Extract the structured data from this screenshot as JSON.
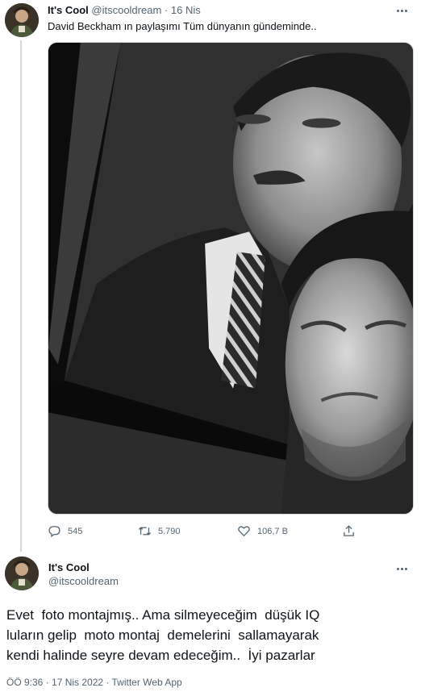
{
  "tweet": {
    "author_name": "It's Cool",
    "author_handle": "@itscooldream",
    "separator": "·",
    "date": "16 Nis",
    "text": "David Beckham ın paylaşımı Tüm dünyanın gündeminde..",
    "media_icon": "photo-portrait-selfie",
    "actions": {
      "reply_count": "545",
      "retweet_count": "5.790",
      "like_count": "106,7 B"
    }
  },
  "reply": {
    "author_name": "It's Cool",
    "author_handle": "@itscooldream",
    "text_lines": [
      "Evet  foto montajmış.. Ama silmeyeceğim  düşük IQ",
      "luların gelip  moto montaj  demelerini  sallamayarak",
      "kendi halinde seyre devam edeceğim..  İyi pazarlar"
    ],
    "timestamp": "ÖÖ 9:36 · 17 Nis 2022 · Twitter Web App"
  },
  "colors": {
    "text_primary": "#0f1419",
    "text_secondary": "#536471",
    "border": "#cfd9de"
  }
}
